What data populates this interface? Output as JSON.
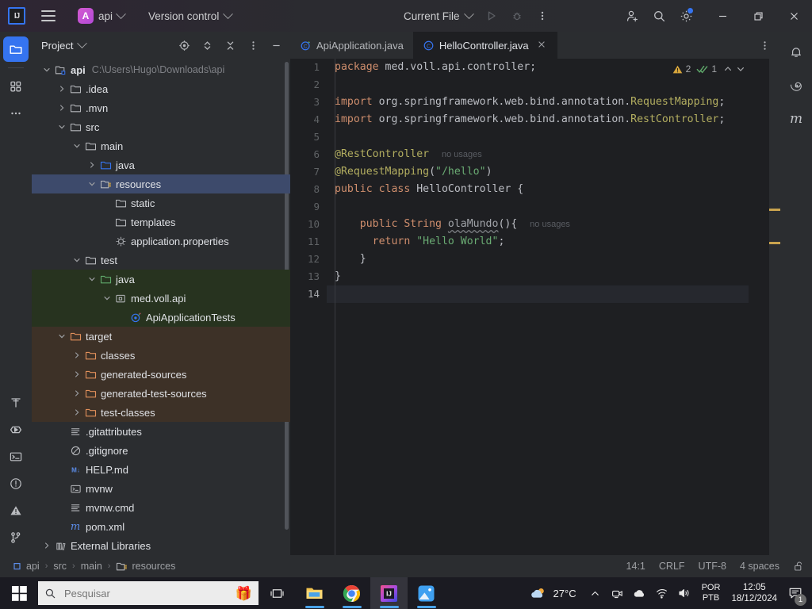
{
  "titlebar": {
    "ide_icon": "intellij-idea-icon",
    "menu_icon": "hamburger-menu-icon",
    "project_badge": "A",
    "project_name": "api",
    "vcs_label": "Version control",
    "run_config": "Current File",
    "run_icon": "run-icon",
    "debug_icon": "debug-icon",
    "more_icon": "more-vertical-icon",
    "add_user_icon": "add-user-icon",
    "search_icon": "search-icon",
    "settings_icon": "gear-icon",
    "settings_badge_color": "#3574f0",
    "minimize_icon": "minimize-icon",
    "maximize_icon": "restore-icon",
    "close_icon": "close-icon"
  },
  "left_rail": {
    "top": [
      {
        "name": "project-tool-window",
        "icon": "folder-icon",
        "active": true
      },
      {
        "name": "commit-tool-window",
        "icon": "structure-icon",
        "active": false
      },
      {
        "name": "more-tool-windows",
        "icon": "more-horizontal-icon",
        "active": false
      }
    ],
    "bottom": [
      {
        "name": "build-tool-window",
        "icon": "hammer-icon"
      },
      {
        "name": "run-tool-window",
        "icon": "play-polygon-icon"
      },
      {
        "name": "terminal-tool-window",
        "icon": "terminal-icon"
      },
      {
        "name": "problems-tool-window",
        "icon": "exclamation-circle-icon"
      },
      {
        "name": "warnings-tool-window",
        "icon": "warning-triangle-icon"
      },
      {
        "name": "git-tool-window",
        "icon": "git-branch-icon"
      }
    ]
  },
  "right_rail": [
    {
      "name": "notifications",
      "icon": "bell-icon"
    },
    {
      "name": "ai-assistant",
      "icon": "spiral-icon"
    },
    {
      "name": "maven",
      "icon": "maven-m-icon"
    }
  ],
  "project_panel": {
    "title": "Project",
    "actions": [
      {
        "name": "select-opened-file",
        "icon": "target-icon"
      },
      {
        "name": "expand-collapse",
        "icon": "expand-collapse-icon"
      },
      {
        "name": "collapse-all",
        "icon": "collapse-all-icon"
      },
      {
        "name": "options-menu",
        "icon": "more-vertical-icon"
      },
      {
        "name": "hide-panel",
        "icon": "minimize-icon"
      }
    ],
    "tree": [
      {
        "label": "api",
        "sub": "C:\\Users\\Hugo\\Downloads\\api",
        "indent": 0,
        "arrow": "down",
        "icon": "module-icon",
        "bold": true
      },
      {
        "label": ".idea",
        "indent": 1,
        "arrow": "right",
        "icon": "folder-icon"
      },
      {
        "label": ".mvn",
        "indent": 1,
        "arrow": "right",
        "icon": "folder-icon"
      },
      {
        "label": "src",
        "indent": 1,
        "arrow": "down",
        "icon": "folder-icon"
      },
      {
        "label": "main",
        "indent": 2,
        "arrow": "down",
        "icon": "folder-icon"
      },
      {
        "label": "java",
        "indent": 3,
        "arrow": "right",
        "icon": "source-root-folder-icon"
      },
      {
        "label": "resources",
        "indent": 3,
        "arrow": "down",
        "icon": "resource-root-folder-icon",
        "selected": true
      },
      {
        "label": "static",
        "indent": 4,
        "arrow": "none",
        "icon": "folder-icon"
      },
      {
        "label": "templates",
        "indent": 4,
        "arrow": "none",
        "icon": "folder-icon"
      },
      {
        "label": "application.properties",
        "indent": 4,
        "arrow": "none",
        "icon": "properties-file-icon"
      },
      {
        "label": "test",
        "indent": 2,
        "arrow": "down",
        "icon": "folder-icon"
      },
      {
        "label": "java",
        "indent": 3,
        "arrow": "down",
        "icon": "test-source-root-folder-icon",
        "tint": "green"
      },
      {
        "label": "med.voll.api",
        "indent": 4,
        "arrow": "down",
        "icon": "package-icon",
        "tint": "green"
      },
      {
        "label": "ApiApplicationTests",
        "indent": 5,
        "arrow": "none",
        "icon": "test-class-icon",
        "tint": "green"
      },
      {
        "label": "target",
        "indent": 1,
        "arrow": "down",
        "icon": "excluded-folder-icon",
        "tint": "orange"
      },
      {
        "label": "classes",
        "indent": 2,
        "arrow": "right",
        "icon": "excluded-folder-icon",
        "tint": "orange"
      },
      {
        "label": "generated-sources",
        "indent": 2,
        "arrow": "right",
        "icon": "excluded-folder-icon",
        "tint": "orange"
      },
      {
        "label": "generated-test-sources",
        "indent": 2,
        "arrow": "right",
        "icon": "excluded-folder-icon",
        "tint": "orange"
      },
      {
        "label": "test-classes",
        "indent": 2,
        "arrow": "right",
        "icon": "excluded-folder-icon",
        "tint": "orange"
      },
      {
        "label": ".gitattributes",
        "indent": 1,
        "arrow": "none",
        "icon": "text-file-icon"
      },
      {
        "label": ".gitignore",
        "indent": 1,
        "arrow": "none",
        "icon": "gitignore-icon"
      },
      {
        "label": "HELP.md",
        "indent": 1,
        "arrow": "none",
        "icon": "markdown-file-icon"
      },
      {
        "label": "mvnw",
        "indent": 1,
        "arrow": "none",
        "icon": "shell-script-icon"
      },
      {
        "label": "mvnw.cmd",
        "indent": 1,
        "arrow": "none",
        "icon": "text-file-icon"
      },
      {
        "label": "pom.xml",
        "indent": 1,
        "arrow": "none",
        "icon": "maven-m-icon"
      },
      {
        "label": "External Libraries",
        "indent": 0,
        "arrow": "right",
        "icon": "library-icon"
      }
    ]
  },
  "editor": {
    "tabs": [
      {
        "label": "ApiApplication.java",
        "icon": "spring-boot-class-icon",
        "active": false,
        "closable": false
      },
      {
        "label": "HelloController.java",
        "icon": "java-class-icon",
        "active": true,
        "closable": true
      }
    ],
    "tab_options_icon": "more-vertical-icon",
    "inspections": {
      "warning_icon": "warning-triangle-icon",
      "warning_count": "2",
      "check_icon": "inspections-ok-icon",
      "check_count": "1",
      "prev_icon": "chevron-up-icon",
      "next_icon": "chevron-down-icon"
    },
    "line_numbers": [
      "1",
      "2",
      "3",
      "4",
      "5",
      "6",
      "7",
      "8",
      "9",
      "10",
      "11",
      "12",
      "13",
      "14"
    ],
    "current_line": 14,
    "lines": [
      {
        "n": 1,
        "tokens": [
          {
            "t": "package ",
            "c": "kw"
          },
          {
            "t": "med.voll.api.controller;",
            "c": "pkg"
          }
        ]
      },
      {
        "n": 2,
        "tokens": []
      },
      {
        "n": 3,
        "tokens": [
          {
            "t": "import ",
            "c": "kw"
          },
          {
            "t": "org.springframework.web.bind.annotation.",
            "c": "pkg"
          },
          {
            "t": "RequestMapping",
            "c": "ann"
          },
          {
            "t": ";",
            "c": "pkg"
          }
        ]
      },
      {
        "n": 4,
        "tokens": [
          {
            "t": "import ",
            "c": "kw"
          },
          {
            "t": "org.springframework.web.bind.annotation.",
            "c": "pkg"
          },
          {
            "t": "RestController",
            "c": "ann"
          },
          {
            "t": ";",
            "c": "pkg"
          }
        ]
      },
      {
        "n": 5,
        "tokens": []
      },
      {
        "n": 6,
        "tokens": [
          {
            "t": "@RestController",
            "c": "ann"
          },
          {
            "t": "  ",
            "c": "pkg"
          },
          {
            "t": "no usages",
            "c": "usages"
          }
        ]
      },
      {
        "n": 7,
        "tokens": [
          {
            "t": "@RequestMapping",
            "c": "ann"
          },
          {
            "t": "(",
            "c": "pkg"
          },
          {
            "t": "\"/hello\"",
            "c": "str"
          },
          {
            "t": ")",
            "c": "pkg"
          }
        ]
      },
      {
        "n": 8,
        "tokens": [
          {
            "t": "public class ",
            "c": "kw"
          },
          {
            "t": "HelloController ",
            "c": "typ"
          },
          {
            "t": "{",
            "c": "pkg"
          }
        ]
      },
      {
        "n": 9,
        "tokens": []
      },
      {
        "n": 10,
        "tokens": [
          {
            "t": "    public String ",
            "c": "kw"
          },
          {
            "t": "olaMundo",
            "c": "mth squiggle"
          },
          {
            "t": "(){",
            "c": "pkg"
          },
          {
            "t": "  ",
            "c": "pkg"
          },
          {
            "t": "no usages",
            "c": "usages"
          }
        ]
      },
      {
        "n": 11,
        "tokens": [
          {
            "t": "      return ",
            "c": "kw"
          },
          {
            "t": "\"Hello World\"",
            "c": "str"
          },
          {
            "t": ";",
            "c": "pkg"
          }
        ]
      },
      {
        "n": 12,
        "tokens": [
          {
            "t": "    }",
            "c": "pkg"
          }
        ]
      },
      {
        "n": 13,
        "tokens": [
          {
            "t": "}",
            "c": "pkg"
          }
        ]
      },
      {
        "n": 14,
        "tokens": []
      }
    ],
    "warning_markers": [
      263,
      305
    ]
  },
  "statusbar": {
    "breadcrumb": [
      "api",
      "src",
      "main",
      "resources"
    ],
    "breadcrumb_root_icon": "module-icon",
    "breadcrumb_leaf_icon": "resource-root-folder-icon",
    "caret_position": "14:1",
    "line_separator": "CRLF",
    "encoding": "UTF-8",
    "indent": "4 spaces",
    "lock_icon": "unlocked-padlock-icon"
  },
  "taskbar": {
    "start_icon": "windows-start-icon",
    "search_icon": "search-icon",
    "search_placeholder": "Pesquisar",
    "search_value": "",
    "gift_icon": "gift-emoji",
    "taskview_icon": "task-view-icon",
    "apps": [
      {
        "name": "file-explorer",
        "icon": "folder-icon",
        "running": true,
        "active": false
      },
      {
        "name": "google-chrome",
        "icon": "chrome-icon",
        "running": true,
        "active": false
      },
      {
        "name": "intellij-idea",
        "icon": "intellij-idea-icon",
        "running": true,
        "active": true
      },
      {
        "name": "photos",
        "icon": "photos-icon",
        "running": true,
        "active": false
      }
    ],
    "weather_temp": "27°C",
    "weather_icon": "partly-cloudy-icon",
    "tray": [
      {
        "name": "show-hidden-icons",
        "icon": "chevron-up-icon"
      },
      {
        "name": "google-meet",
        "icon": "camera-icon"
      },
      {
        "name": "onedrive",
        "icon": "cloud-icon"
      },
      {
        "name": "network",
        "icon": "wifi-icon"
      },
      {
        "name": "volume",
        "icon": "speaker-icon"
      }
    ],
    "language_line1": "POR",
    "language_line2": "PTB",
    "clock_time": "12:05",
    "clock_date": "18/12/2024",
    "notification_icon": "notification-icon",
    "notification_count": "1"
  }
}
